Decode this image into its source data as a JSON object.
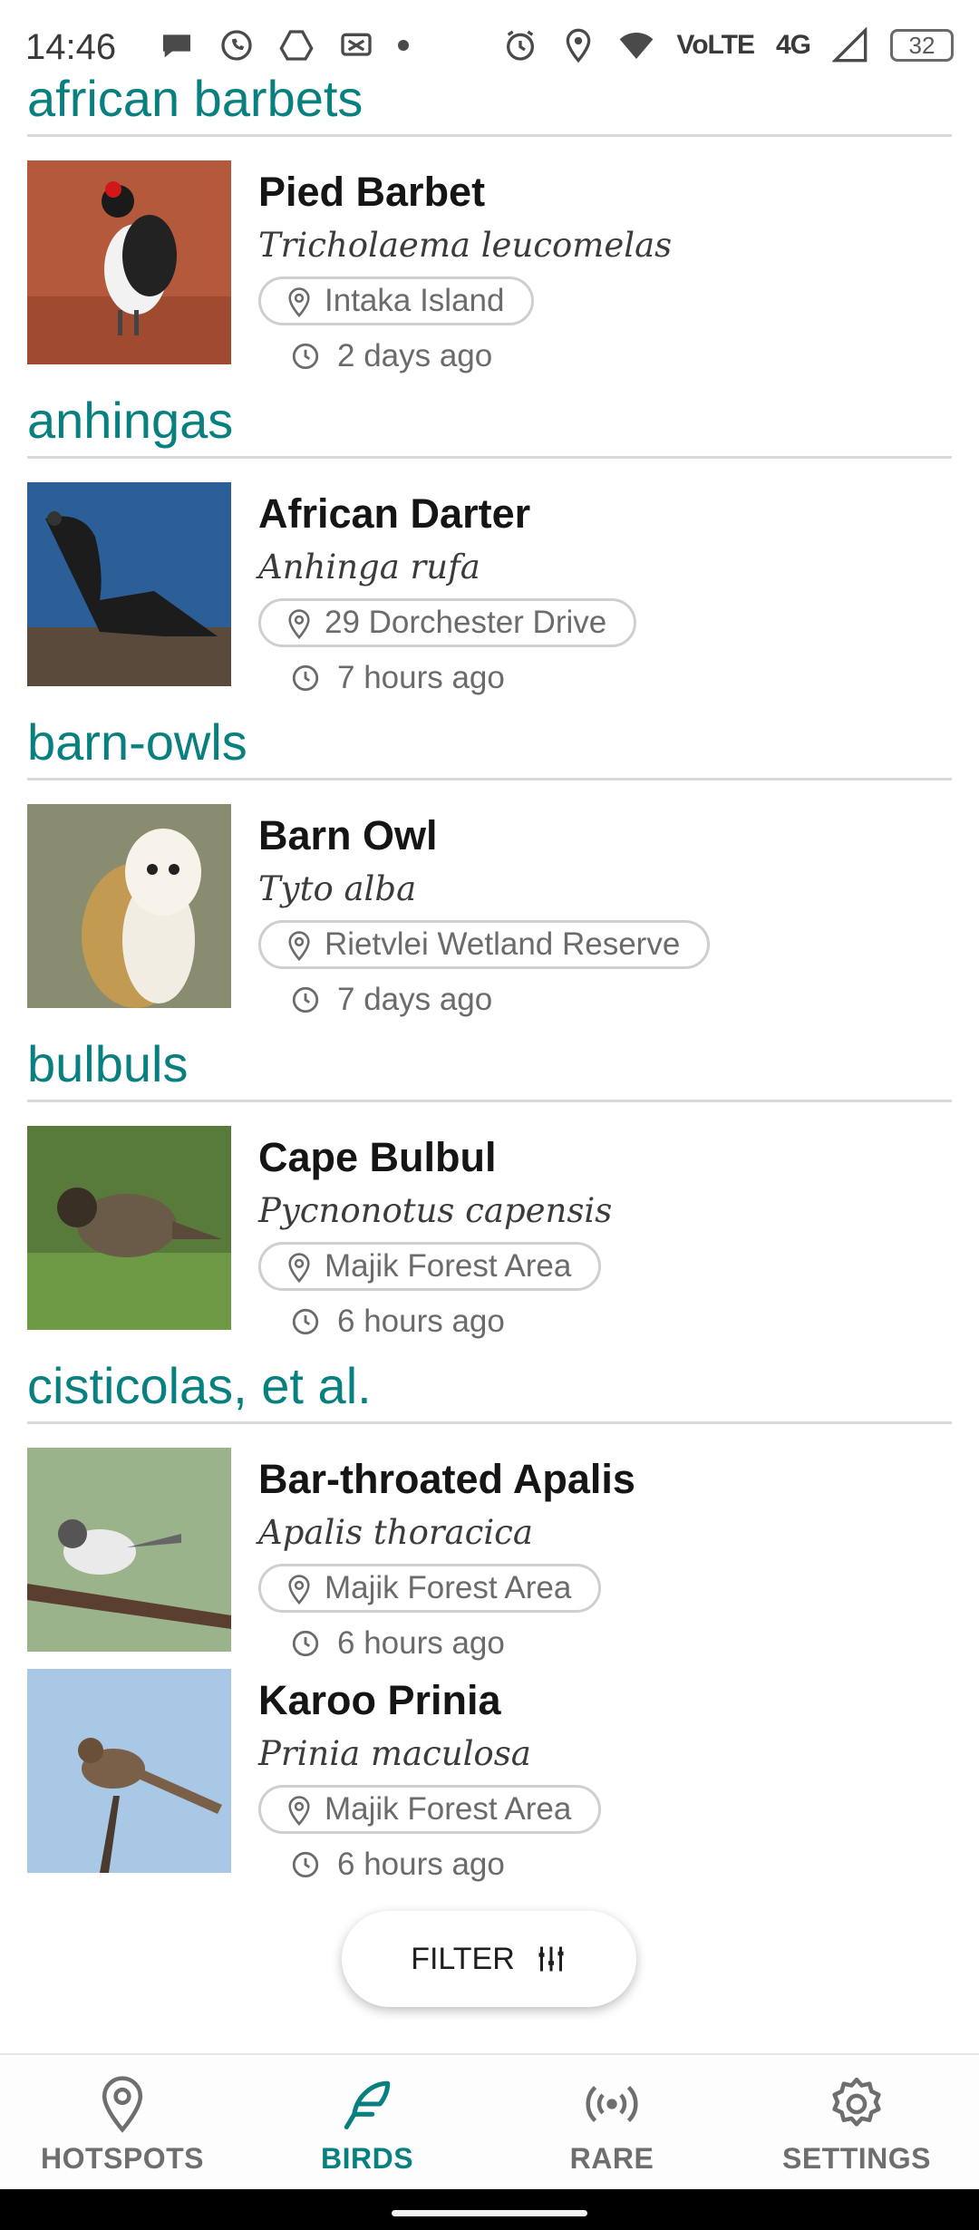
{
  "status_bar": {
    "time": "14:46",
    "network": "4G",
    "volte": "VoLTE",
    "battery": "32"
  },
  "groups": [
    {
      "title": "african barbets",
      "entries": [
        {
          "name": "Pied Barbet",
          "scientific": "Tricholaema leucomelas",
          "location": "Intaka Island",
          "time": "2 days ago"
        }
      ]
    },
    {
      "title": "anhingas",
      "entries": [
        {
          "name": "African Darter",
          "scientific": "Anhinga rufa",
          "location": "29 Dorchester Drive",
          "time": "7 hours ago"
        }
      ]
    },
    {
      "title": "barn-owls",
      "entries": [
        {
          "name": "Barn Owl",
          "scientific": "Tyto alba",
          "location": "Rietvlei Wetland Reserve",
          "time": "7 days ago"
        }
      ]
    },
    {
      "title": "bulbuls",
      "entries": [
        {
          "name": "Cape Bulbul",
          "scientific": "Pycnonotus capensis",
          "location": "Majik Forest Area",
          "time": "6 hours ago"
        }
      ]
    },
    {
      "title": "cisticolas, et al.",
      "entries": [
        {
          "name": "Bar-throated Apalis",
          "scientific": "Apalis thoracica",
          "location": "Majik Forest Area",
          "time": "6 hours ago"
        },
        {
          "name": "Karoo Prinia",
          "scientific": "Prinia maculosa",
          "location": "Majik Forest Area",
          "time": "6 hours ago"
        }
      ]
    }
  ],
  "fab": {
    "label": "FILTER",
    "icon": "sliders-icon"
  },
  "bottom_nav": [
    {
      "label": "HOTSPOTS",
      "icon": "location-pin-icon",
      "active": false
    },
    {
      "label": "BIRDS",
      "icon": "feather-icon",
      "active": true
    },
    {
      "label": "RARE",
      "icon": "broadcast-icon",
      "active": false
    },
    {
      "label": "SETTINGS",
      "icon": "gear-icon",
      "active": false
    }
  ],
  "colors": {
    "accent": "#08807f",
    "divider": "#d9d9d9",
    "muted_text": "#6b6b6b"
  }
}
